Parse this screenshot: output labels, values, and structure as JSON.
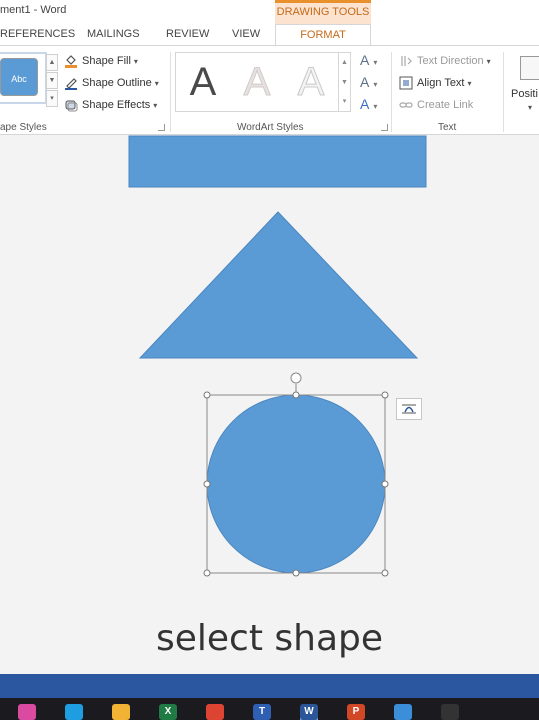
{
  "window": {
    "title": "ment1 - Word",
    "context_group": "DRAWING TOOLS"
  },
  "tabs": [
    {
      "label": "REFERENCES"
    },
    {
      "label": "MAILINGS"
    },
    {
      "label": "REVIEW"
    },
    {
      "label": "VIEW"
    },
    {
      "label": "FORMAT",
      "active": true
    }
  ],
  "ribbon": {
    "shape_styles": {
      "preview_label": "Abc",
      "group_label": "ape Styles",
      "commands": [
        {
          "label": "Shape Fill",
          "icon": "paint-bucket-icon"
        },
        {
          "label": "Shape Outline",
          "icon": "pen-outline-icon"
        },
        {
          "label": "Shape Effects",
          "icon": "shape-effects-icon"
        }
      ]
    },
    "wordart_styles": {
      "group_label": "WordArt Styles",
      "tiles": [
        "A",
        "A",
        "A"
      ],
      "side": [
        "A",
        "A",
        "A"
      ]
    },
    "text": {
      "group_label": "Text",
      "commands": [
        {
          "label": "Text Direction",
          "icon": "text-direction-icon",
          "disabled": true
        },
        {
          "label": "Align Text",
          "icon": "align-text-icon",
          "disabled": false
        },
        {
          "label": "Create Link",
          "icon": "link-icon",
          "disabled": true
        }
      ]
    },
    "arrange": {
      "position_label": "Positi"
    }
  },
  "colors": {
    "shape_fill": "#5b9bd5",
    "shape_outline": "#4a86c2",
    "accent": "#c56a1a",
    "taskbar_accent": "#2a57a0"
  },
  "document": {
    "shapes": [
      "rectangle",
      "triangle",
      "circle"
    ],
    "selected_shape": "circle"
  },
  "caption": "select shape",
  "taskbar": {
    "apps": [
      {
        "name": "copilot-icon",
        "color": "#d94aa0",
        "glyph": ""
      },
      {
        "name": "edge-icon",
        "color": "#1e9de0",
        "glyph": ""
      },
      {
        "name": "file-explorer-icon",
        "color": "#f2b233",
        "glyph": ""
      },
      {
        "name": "excel-icon",
        "color": "#1f7a44",
        "glyph": "X"
      },
      {
        "name": "chrome-icon",
        "color": "#dd4433",
        "glyph": ""
      },
      {
        "name": "teams-icon",
        "color": "#2f5fb3",
        "glyph": "T"
      },
      {
        "name": "word-icon",
        "color": "#2b579a",
        "glyph": "W"
      },
      {
        "name": "powerpoint-icon",
        "color": "#d24726",
        "glyph": "P"
      },
      {
        "name": "maps-icon",
        "color": "#3a8fd8",
        "glyph": ""
      },
      {
        "name": "obs-icon",
        "color": "#333333",
        "glyph": ""
      }
    ]
  }
}
